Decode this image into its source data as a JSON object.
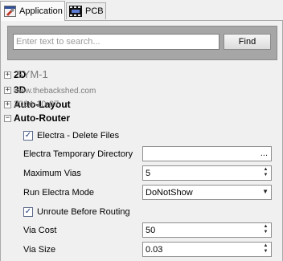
{
  "tabs": [
    {
      "label": "Application",
      "active": true,
      "icon": "application-settings-icon"
    },
    {
      "label": "PCB",
      "active": false,
      "icon": "pcb-board-icon"
    }
  ],
  "search": {
    "placeholder": "Enter text to search...",
    "value": "",
    "button_label": "Find"
  },
  "categories": [
    {
      "symbol": "+",
      "label": "2D",
      "expanded": false
    },
    {
      "symbol": "+",
      "label": "3D",
      "expanded": false
    },
    {
      "symbol": "+",
      "label": "Auto-Layout",
      "expanded": false
    },
    {
      "symbol": "−",
      "label": "Auto-Router",
      "expanded": true
    }
  ],
  "overlay_text": {
    "sym": "SYM-1",
    "site": "www.thebackshed.com",
    "year": "2024-10-07"
  },
  "properties": {
    "electra_delete_files": {
      "label": "Electra - Delete Files",
      "checked": true
    },
    "electra_temp_dir": {
      "label": "Electra Temporary Directory",
      "value": "",
      "button": "..."
    },
    "max_vias": {
      "label": "Maximum Vias",
      "value": "5"
    },
    "run_electra_mode": {
      "label": "Run Electra Mode",
      "value": "DoNotShow"
    },
    "unroute_before_routing": {
      "label": "Unroute Before Routing",
      "checked": true
    },
    "via_cost": {
      "label": "Via Cost",
      "value": "50"
    },
    "via_size": {
      "label": "Via Size",
      "value": "0.03"
    }
  },
  "glyphs": {
    "check": "✓",
    "spin_up": "▲",
    "spin_down": "▼",
    "dropdown": "▼"
  }
}
